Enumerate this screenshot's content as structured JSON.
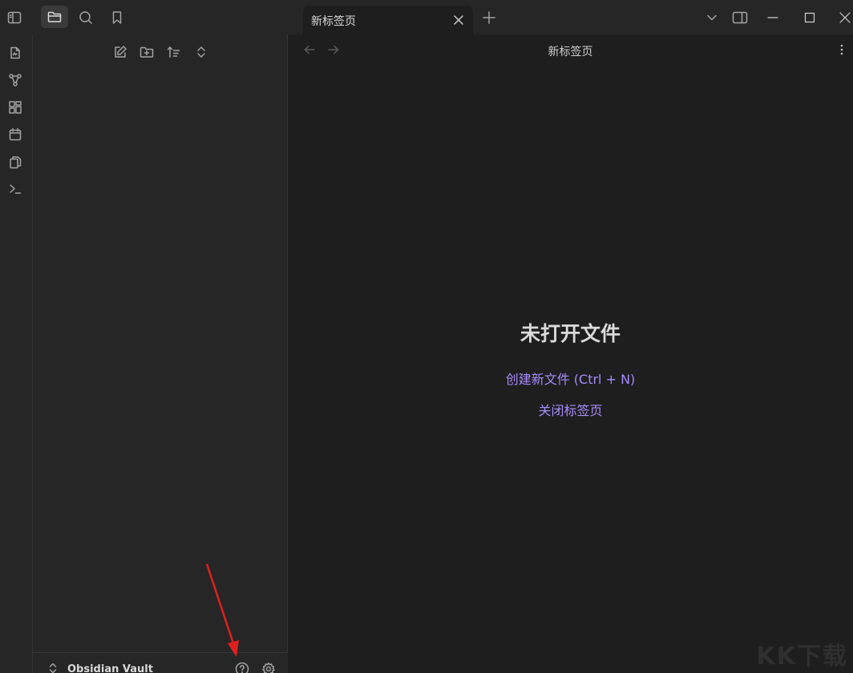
{
  "tab": {
    "title": "新标签页"
  },
  "view": {
    "title": "新标签页"
  },
  "empty_state": {
    "title": "未打开文件",
    "create_link": "创建新文件 (Ctrl + N)",
    "close_link": "关闭标签页"
  },
  "vault": {
    "name": "Obsidian Vault"
  },
  "watermark": "KK下载",
  "colors": {
    "accent": "#a78bfa",
    "annotation_arrow": "#e02020"
  },
  "icons": {
    "titlebar": [
      "sidebar-toggle-icon",
      "folder-icon",
      "search-icon",
      "bookmark-icon",
      "tab-close-icon",
      "new-tab-icon",
      "chevron-down-icon",
      "right-sidebar-toggle-icon",
      "minimize-icon",
      "maximize-icon",
      "close-window-icon"
    ],
    "ribbon": [
      "quick-switcher-icon",
      "graph-view-icon",
      "canvas-icon",
      "daily-note-icon",
      "templates-icon",
      "command-palette-icon"
    ],
    "explorer": [
      "new-note-icon",
      "new-folder-icon",
      "sort-icon",
      "collapse-expand-icon"
    ],
    "view": [
      "back-arrow-icon",
      "forward-arrow-icon",
      "more-options-icon"
    ],
    "vault_bar": [
      "vault-switcher-icon",
      "help-icon",
      "settings-icon"
    ]
  }
}
